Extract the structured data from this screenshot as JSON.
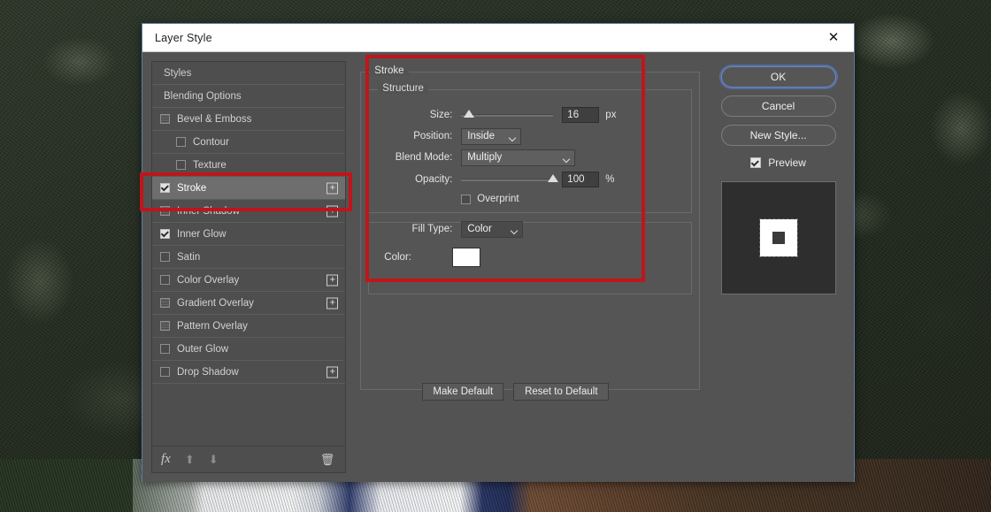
{
  "window": {
    "title": "Layer Style",
    "close_icon": "close-icon"
  },
  "styles_list": {
    "items": [
      {
        "label": "Styles",
        "type": "plain",
        "checkbox": "none",
        "plus": false,
        "selected": false
      },
      {
        "label": "Blending Options",
        "type": "plain",
        "checkbox": "none",
        "plus": false,
        "selected": false
      },
      {
        "label": "Bevel & Emboss",
        "type": "normal",
        "checkbox": "grid",
        "plus": false,
        "selected": false
      },
      {
        "label": "Contour",
        "type": "indent",
        "checkbox": "empty",
        "plus": false,
        "selected": false
      },
      {
        "label": "Texture",
        "type": "indent",
        "checkbox": "empty",
        "plus": false,
        "selected": false
      },
      {
        "label": "Stroke",
        "type": "normal",
        "checkbox": "checked",
        "plus": true,
        "selected": true
      },
      {
        "label": "Inner Shadow",
        "type": "normal",
        "checkbox": "grid",
        "plus": true,
        "selected": false
      },
      {
        "label": "Inner Glow",
        "type": "normal",
        "checkbox": "checked",
        "plus": false,
        "selected": false
      },
      {
        "label": "Satin",
        "type": "normal",
        "checkbox": "empty",
        "plus": false,
        "selected": false
      },
      {
        "label": "Color Overlay",
        "type": "normal",
        "checkbox": "empty",
        "plus": true,
        "selected": false
      },
      {
        "label": "Gradient Overlay",
        "type": "normal",
        "checkbox": "grid",
        "plus": true,
        "selected": false
      },
      {
        "label": "Pattern Overlay",
        "type": "normal",
        "checkbox": "grid",
        "plus": false,
        "selected": false
      },
      {
        "label": "Outer Glow",
        "type": "normal",
        "checkbox": "empty",
        "plus": false,
        "selected": false
      },
      {
        "label": "Drop Shadow",
        "type": "normal",
        "checkbox": "empty",
        "plus": true,
        "selected": false
      }
    ],
    "toolbar": {
      "fx_label": "fx",
      "move_up_icon": "arrow-up-icon",
      "move_down_icon": "arrow-down-icon",
      "delete_icon": "trash-icon"
    }
  },
  "stroke_panel": {
    "title": "Stroke",
    "structure": {
      "legend": "Structure",
      "size_label": "Size:",
      "size_value": "16",
      "size_unit": "px",
      "size_slider_percent": 8,
      "position_label": "Position:",
      "position_value": "Inside",
      "blend_mode_label": "Blend Mode:",
      "blend_mode_value": "Multiply",
      "opacity_label": "Opacity:",
      "opacity_value": "100",
      "opacity_unit": "%",
      "opacity_slider_percent": 100,
      "overprint_label": "Overprint",
      "overprint_checked": false
    },
    "fill": {
      "fill_type_label": "Fill Type:",
      "fill_type_value": "Color",
      "color_label": "Color:",
      "color_value": "#ffffff"
    }
  },
  "footer": {
    "make_default": "Make Default",
    "reset_to_default": "Reset to Default"
  },
  "actions": {
    "ok": "OK",
    "cancel": "Cancel",
    "new_style": "New Style...",
    "preview_label": "Preview",
    "preview_checked": true
  },
  "annotations": {
    "color": "#c0151a",
    "boxes": [
      {
        "name": "stroke-list-item-highlight"
      },
      {
        "name": "stroke-settings-highlight"
      }
    ]
  }
}
